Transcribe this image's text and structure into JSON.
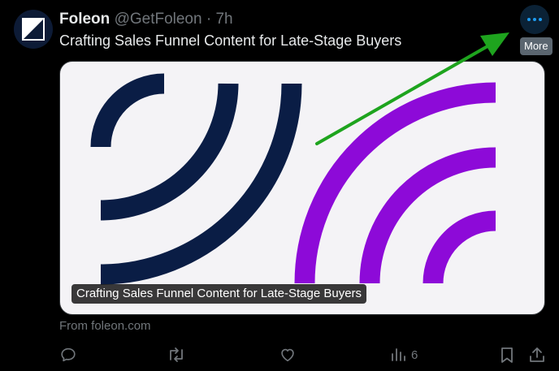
{
  "post": {
    "author_name": "Foleon",
    "handle": "@GetFoleon",
    "separator": "·",
    "time": "7h",
    "text": "Crafting Sales Funnel Content for Late-Stage Buyers",
    "more_tooltip": "More"
  },
  "card": {
    "caption": "Crafting Sales Funnel Content for Late-Stage Buyers",
    "source": "From foleon.com",
    "colors": {
      "background": "#f4f3f6",
      "navy_arcs": "#0a1d45",
      "purple_arcs": "#8d0ad8"
    }
  },
  "actions": {
    "reply_icon": "reply-icon",
    "repost_icon": "repost-icon",
    "like_icon": "heart-icon",
    "views_icon": "views-icon",
    "views_count": "6",
    "bookmark_icon": "bookmark-icon",
    "share_icon": "share-icon"
  },
  "colors": {
    "accent": "#1d9bf0",
    "annotation_arrow": "#1ea41e",
    "muted_text": "#71767b"
  }
}
